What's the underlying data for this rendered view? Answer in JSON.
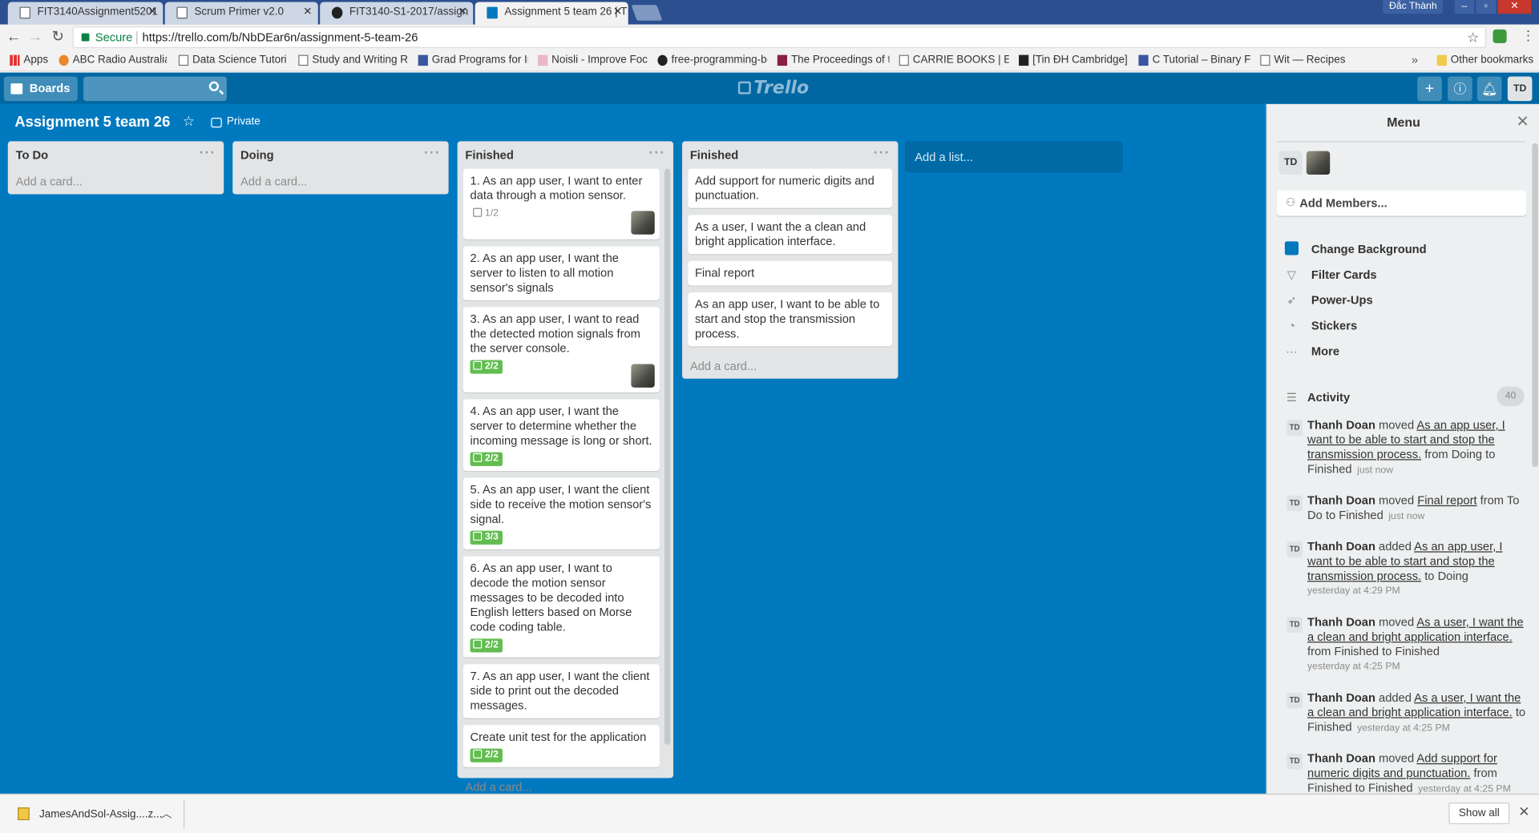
{
  "browser": {
    "tabs": [
      {
        "title": "FIT3140Assignment5201",
        "active": false
      },
      {
        "title": "Scrum Primer v2.0",
        "active": false
      },
      {
        "title": "FIT3140-S1-2017/assign",
        "active": false
      },
      {
        "title": "Assignment 5 team 26 | T",
        "active": true
      }
    ],
    "profile_name": "Đắc Thành",
    "secure_label": "Secure",
    "url": "https://trello.com/b/NbDEar6n/assignment-5-team-26",
    "bookmarks": [
      {
        "label": "Apps",
        "icon": "apps-icon"
      },
      {
        "label": "ABC Radio Australia |",
        "icon": "radio-icon"
      },
      {
        "label": "Data Science Tutorials",
        "icon": "page-icon"
      },
      {
        "label": "Study and Writing Re",
        "icon": "page-icon"
      },
      {
        "label": "Grad Programs for Int",
        "icon": "site-icon"
      },
      {
        "label": "Noisli - Improve Focu",
        "icon": "site-icon"
      },
      {
        "label": "free-programming-bo",
        "icon": "github-icon"
      },
      {
        "label": "The Proceedings of th",
        "icon": "site-icon"
      },
      {
        "label": "CARRIE BOOKS | E-bo",
        "icon": "page-icon"
      },
      {
        "label": "[Tin ĐH Cambridge] K",
        "icon": "site-icon"
      },
      {
        "label": "C Tutorial – Binary File",
        "icon": "site-icon"
      },
      {
        "label": "Wit — Recipes",
        "icon": "page-icon"
      }
    ],
    "other_bookmarks": "Other bookmarks"
  },
  "trello": {
    "boards_label": "Boards",
    "logo": "Trello",
    "user_initials": "TD",
    "board_title": "Assignment 5 team 26",
    "visibility": "Private",
    "add_card": "Add a card...",
    "add_list": "Add a list...",
    "lists": [
      {
        "name": "To Do",
        "cards": []
      },
      {
        "name": "Doing",
        "cards": []
      },
      {
        "name": "Finished",
        "cards": [
          {
            "text": "1. As an app user, I want to enter data through a motion sensor.",
            "checklist": "1/2",
            "complete": false,
            "member": true
          },
          {
            "text": "2. As an app user, I want the server to listen to all motion sensor's signals",
            "checklist": "",
            "complete": false,
            "member": false
          },
          {
            "text": "3. As an app user, I want to read the detected motion signals from the server console.",
            "checklist": "2/2",
            "complete": true,
            "member": true
          },
          {
            "text": "4. As an app user, I want the server to determine whether the incoming message is long or short.",
            "checklist": "2/2",
            "complete": true,
            "member": false
          },
          {
            "text": "5. As an app user, I want the client side to receive the motion sensor's signal.",
            "checklist": "3/3",
            "complete": true,
            "member": false
          },
          {
            "text": "6. As an app user, I want to decode the motion sensor messages to be decoded into English letters based on Morse code coding table.",
            "checklist": "2/2",
            "complete": true,
            "member": false
          },
          {
            "text": "7. As an app user, I want the client side to print out the decoded messages.",
            "checklist": "",
            "complete": false,
            "member": false
          },
          {
            "text": "Create unit test for the application",
            "checklist": "2/2",
            "complete": true,
            "member": false
          }
        ]
      },
      {
        "name": "Finished",
        "cards": [
          {
            "text": "Add support for numeric digits and punctuation."
          },
          {
            "text": "As a user, I want the a clean and bright application interface."
          },
          {
            "text": "Final report"
          },
          {
            "text": "As an app user, I want to be able to start and stop the transmission process."
          }
        ]
      }
    ],
    "menu": {
      "title": "Menu",
      "member_initials": "TD",
      "add_members": "Add Members...",
      "items": [
        "Change Background",
        "Filter Cards",
        "Power-Ups",
        "Stickers",
        "More"
      ],
      "activity_label": "Activity",
      "activity_count": "40",
      "activity": [
        {
          "user": "Thanh Doan",
          "verb": "moved",
          "card": "As an app user, I want to be able to start and stop the transmission process.",
          "rest": "from Doing to Finished",
          "time": "just now"
        },
        {
          "user": "Thanh Doan",
          "verb": "moved",
          "card": "Final report",
          "rest": "from To Do to Finished",
          "time": "just now"
        },
        {
          "user": "Thanh Doan",
          "verb": "added",
          "card": "As an app user, I want to be able to start and stop the transmission process.",
          "rest": "to Doing",
          "time": "yesterday at 4:29 PM"
        },
        {
          "user": "Thanh Doan",
          "verb": "moved",
          "card": "As a user, I want the a clean and bright application interface.",
          "rest": "from Finished to Finished",
          "time": "yesterday at 4:25 PM"
        },
        {
          "user": "Thanh Doan",
          "verb": "added",
          "card": "As a user, I want the a clean and bright application interface.",
          "rest": "to Finished",
          "time": "yesterday at 4:25 PM"
        },
        {
          "user": "Thanh Doan",
          "verb": "moved",
          "card": "Add support for numeric digits and punctuation.",
          "rest": "from Finished to Finished",
          "time": "yesterday at 4:25 PM"
        }
      ]
    }
  },
  "downloads": {
    "file": "JamesAndSol-Assig....z...",
    "show_all": "Show all"
  },
  "colors": {
    "board": "#0079bf",
    "header": "#0067a3",
    "badge_green": "#61bd4f"
  }
}
